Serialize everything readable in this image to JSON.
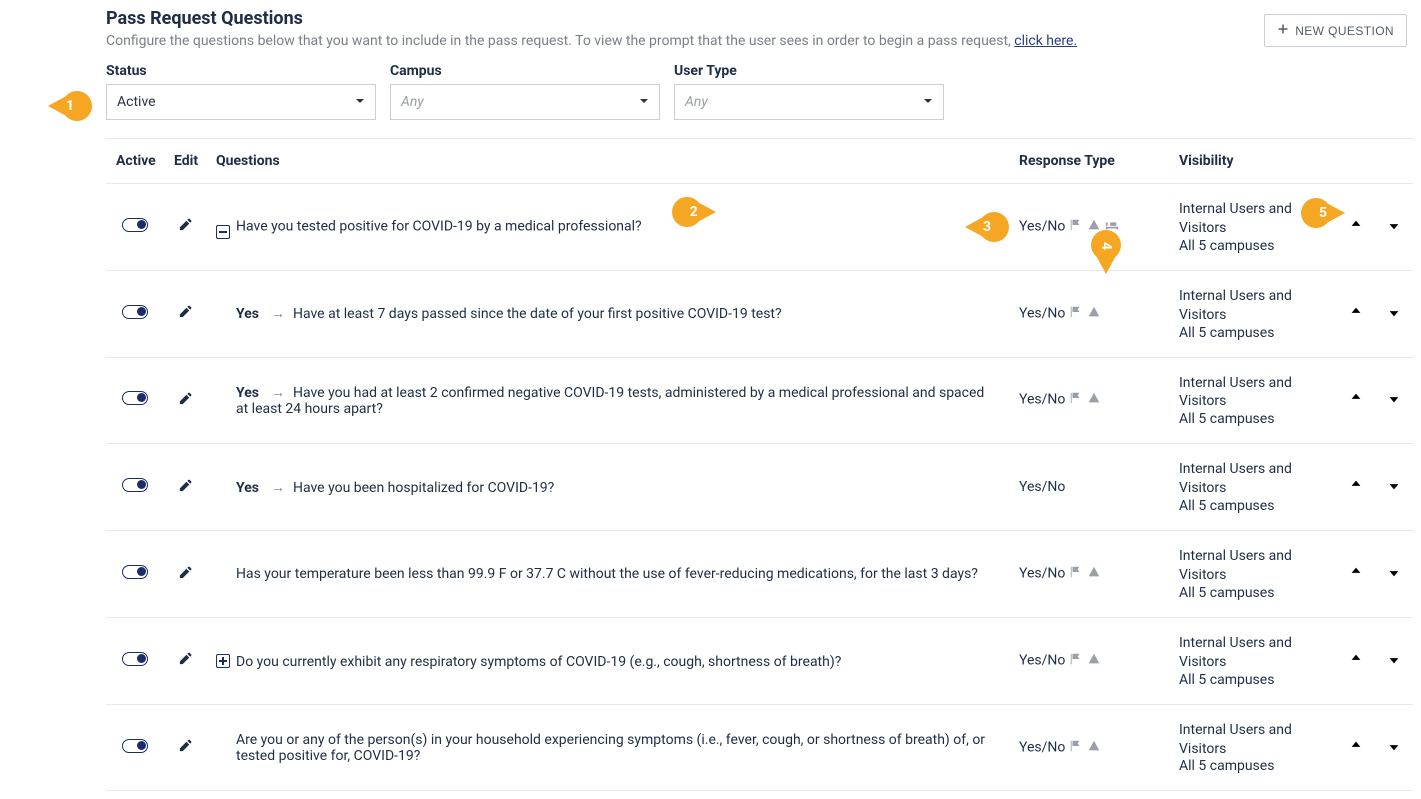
{
  "header": {
    "title": "Pass Request Questions",
    "subtitle_a": "Configure the questions below that you want to include in the pass request. To view the prompt that the user sees in order to begin a pass request, ",
    "subtitle_link": "click here.",
    "new_question_label": "NEW QUESTION"
  },
  "filters": {
    "status_label": "Status",
    "status_value": "Active",
    "campus_label": "Campus",
    "campus_value": "Any",
    "usertype_label": "User Type",
    "usertype_value": "Any"
  },
  "columns": {
    "active": "Active",
    "edit": "Edit",
    "questions": "Questions",
    "response_type": "Response Type",
    "visibility": "Visibility"
  },
  "visibility_default": {
    "line1": "Internal Users and Visitors",
    "line2": "All 5 campuses"
  },
  "rows": [
    {
      "id": "q1",
      "tree": "minus",
      "indent": false,
      "prefix": "",
      "text": "Have you tested positive for COVID-19 by a medical professional?",
      "resp": "Yes/No",
      "icons": [
        "flag",
        "warn",
        "bed"
      ],
      "up": "dim",
      "down": "strong",
      "callout2": true,
      "callout3": true,
      "callout4": true,
      "callout5": true
    },
    {
      "id": "q2",
      "tree": "",
      "indent": true,
      "prefix": "Yes",
      "text": "Have at least 7 days passed since the date of your first positive COVID-19 test?",
      "resp": "Yes/No",
      "icons": [
        "flag",
        "warn"
      ],
      "up": "dim",
      "down": "dim"
    },
    {
      "id": "q3",
      "tree": "",
      "indent": true,
      "prefix": "Yes",
      "text": "Have you had at least 2 confirmed negative COVID-19 tests, administered by a medical professional and spaced at least 24 hours apart?",
      "resp": "Yes/No",
      "icons": [
        "flag",
        "warn"
      ],
      "up": "dim",
      "down": "dim"
    },
    {
      "id": "q4",
      "tree": "",
      "indent": true,
      "prefix": "Yes",
      "text": "Have you been hospitalized for COVID-19?",
      "resp": "Yes/No",
      "icons": [],
      "up": "dim",
      "down": "dim"
    },
    {
      "id": "q5",
      "tree": "",
      "indent": true,
      "prefix": "",
      "text": "Has your temperature been less than 99.9 F or 37.7 C without the use of fever-reducing medications, for the last 3 days?",
      "resp": "Yes/No",
      "icons": [
        "flag",
        "warn"
      ],
      "up": "strong",
      "down": "strong"
    },
    {
      "id": "q6",
      "tree": "plus",
      "indent": false,
      "prefix": "",
      "text": "Do you currently exhibit any respiratory symptoms of COVID-19 (e.g., cough, shortness of breath)?",
      "resp": "Yes/No",
      "icons": [
        "flag",
        "warn"
      ],
      "up": "strong",
      "down": "strong"
    },
    {
      "id": "q7",
      "tree": "",
      "indent": true,
      "prefix": "",
      "text": "Are you or any of the person(s) in your household experiencing symptoms (i.e., fever, cough, or shortness of breath) of, or tested positive for, COVID-19?",
      "resp": "Yes/No",
      "icons": [
        "flag",
        "warn"
      ],
      "up": "strong",
      "down": "strong"
    }
  ],
  "callouts": {
    "c1": "1",
    "c2": "2",
    "c3": "3",
    "c4": "4",
    "c5": "5"
  }
}
